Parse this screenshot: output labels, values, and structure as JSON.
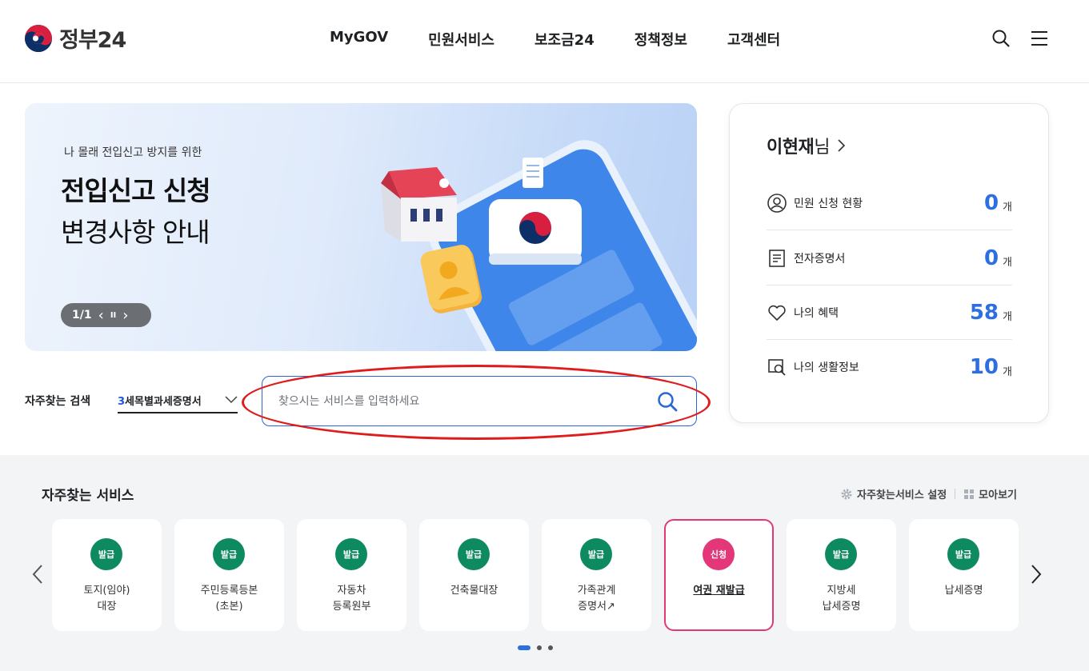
{
  "header": {
    "logo_text": "정부24",
    "nav": [
      "MyGOV",
      "민원서비스",
      "보조금24",
      "정책정보",
      "고객센터"
    ],
    "search_icon": "search-icon",
    "menu_icon": "hamburger-menu-icon"
  },
  "banner": {
    "subtitle": "나 몰래 전입신고 방지를 위한",
    "title_line1": "전입신고 신청",
    "title_line2": "변경사항 안내",
    "pager_text": "1/1",
    "prev": "‹",
    "pause": "II",
    "next": "›"
  },
  "search": {
    "fav_label": "자주찾는 검색",
    "fav_rank": "3",
    "fav_value": "세목별과세증명서",
    "placeholder": "찾으시는 서비스를 입력하세요"
  },
  "user": {
    "name": "이현재",
    "suffix": "님",
    "stats": [
      {
        "label": "민원 신청 현황",
        "value": "0",
        "unit": "개",
        "icon": "person-circle-icon"
      },
      {
        "label": "전자증명서",
        "value": "0",
        "unit": "개",
        "icon": "document-icon"
      },
      {
        "label": "나의 혜택",
        "value": "58",
        "unit": "개",
        "icon": "heart-icon"
      },
      {
        "label": "나의 생활정보",
        "value": "10",
        "unit": "개",
        "icon": "search-document-icon"
      }
    ]
  },
  "services": {
    "title": "자주찾는 서비스",
    "settings_link": "자주찾는서비스 설정",
    "view_all_link": "모아보기",
    "items": [
      {
        "badge": "발급",
        "name": "토지(임야)\n대장"
      },
      {
        "badge": "발급",
        "name": "주민등록등본\n(초본)"
      },
      {
        "badge": "발급",
        "name": "자동차\n등록원부"
      },
      {
        "badge": "발급",
        "name": "건축물대장"
      },
      {
        "badge": "발급",
        "name": "가족관계\n증명서↗"
      },
      {
        "badge": "신청",
        "name": "여권 재발급"
      },
      {
        "badge": "발급",
        "name": "지방세\n납세증명"
      },
      {
        "badge": "발급",
        "name": "납세증명"
      }
    ]
  },
  "colors": {
    "primary": "#2d6fe0",
    "badge_green": "#0d8a5f",
    "badge_pink": "#e3377a",
    "annotation_red": "#e01b1b"
  }
}
